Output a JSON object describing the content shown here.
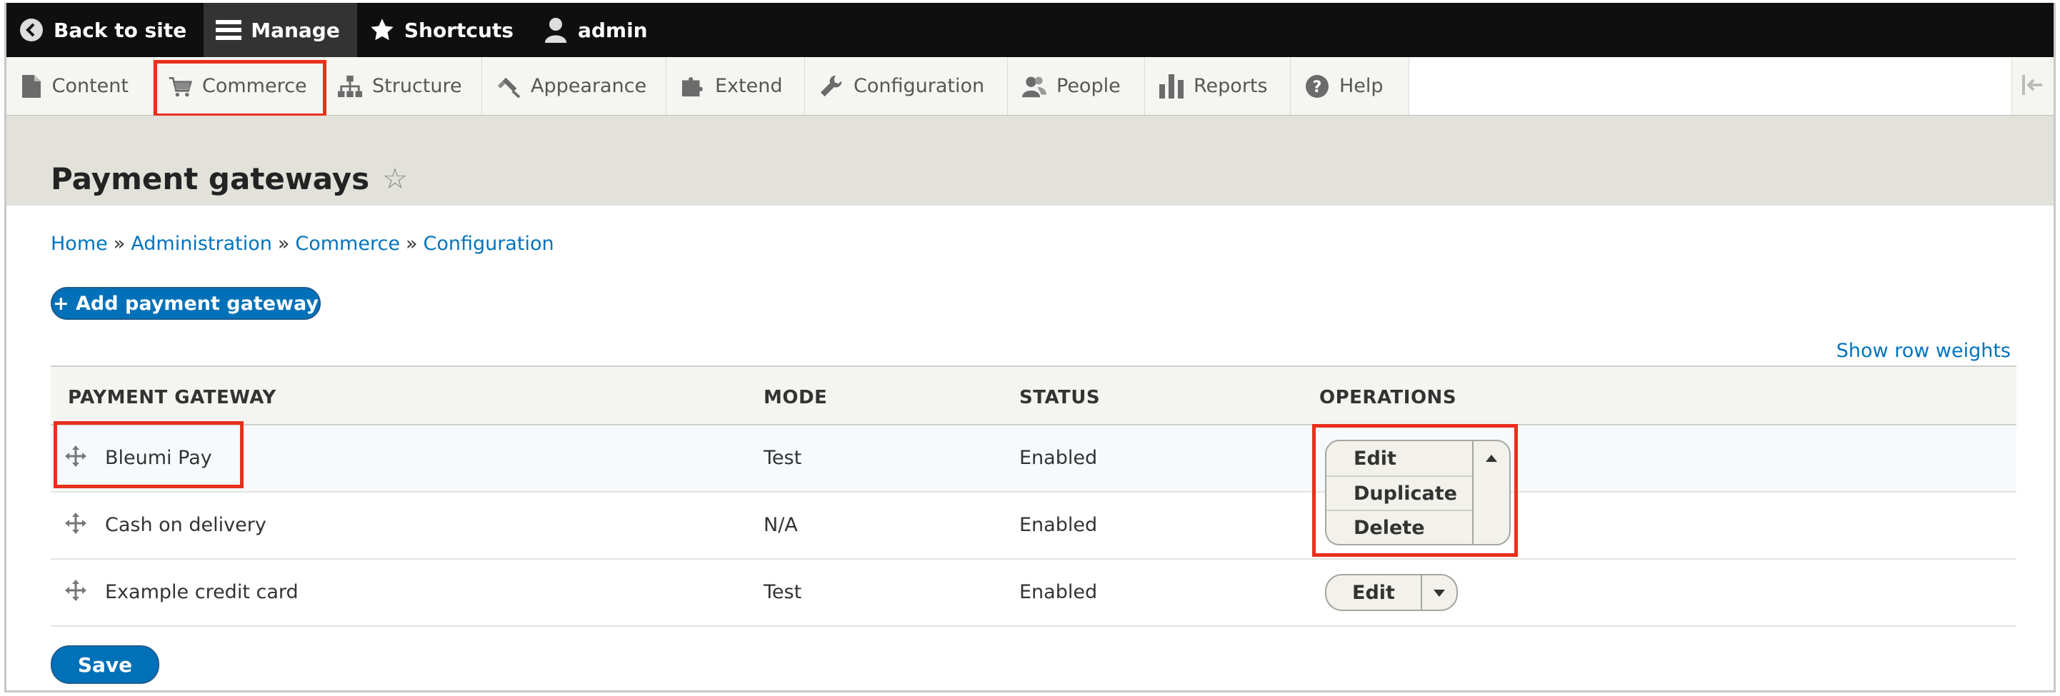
{
  "toolbar": {
    "back": "Back to site",
    "manage": "Manage",
    "shortcuts": "Shortcuts",
    "user": "admin"
  },
  "tray": {
    "items": [
      {
        "label": "Content",
        "icon": "file-icon"
      },
      {
        "label": "Commerce",
        "icon": "cart-icon"
      },
      {
        "label": "Structure",
        "icon": "sitemap-icon"
      },
      {
        "label": "Appearance",
        "icon": "paintbrush-icon"
      },
      {
        "label": "Extend",
        "icon": "puzzle-icon"
      },
      {
        "label": "Configuration",
        "icon": "wrench-icon"
      },
      {
        "label": "People",
        "icon": "people-icon"
      },
      {
        "label": "Reports",
        "icon": "bar-chart-icon"
      },
      {
        "label": "Help",
        "icon": "help-icon"
      }
    ]
  },
  "page": {
    "title": "Payment gateways",
    "star": "☆"
  },
  "breadcrumb": {
    "items": [
      "Home",
      "Administration",
      "Commerce",
      "Configuration"
    ],
    "separator": "»"
  },
  "actions": {
    "add": "+ Add payment gateway",
    "row_weights": "Show row weights",
    "save": "Save"
  },
  "table": {
    "headers": [
      "PAYMENT GATEWAY",
      "MODE",
      "STATUS",
      "OPERATIONS"
    ],
    "rows": [
      {
        "name": "Bleumi Pay",
        "mode": "Test",
        "status": "Enabled",
        "operations": [
          "Edit",
          "Duplicate",
          "Delete"
        ]
      },
      {
        "name": "Cash on delivery",
        "mode": "N/A",
        "status": "Enabled",
        "operations": []
      },
      {
        "name": "Example credit card",
        "mode": "Test",
        "status": "Enabled",
        "operations": [
          "Edit"
        ]
      }
    ]
  },
  "colors": {
    "highlight": "#e8301c",
    "link": "#0074bd",
    "primary_button": "#0071b8",
    "toolbar": "#0f0f0f"
  }
}
